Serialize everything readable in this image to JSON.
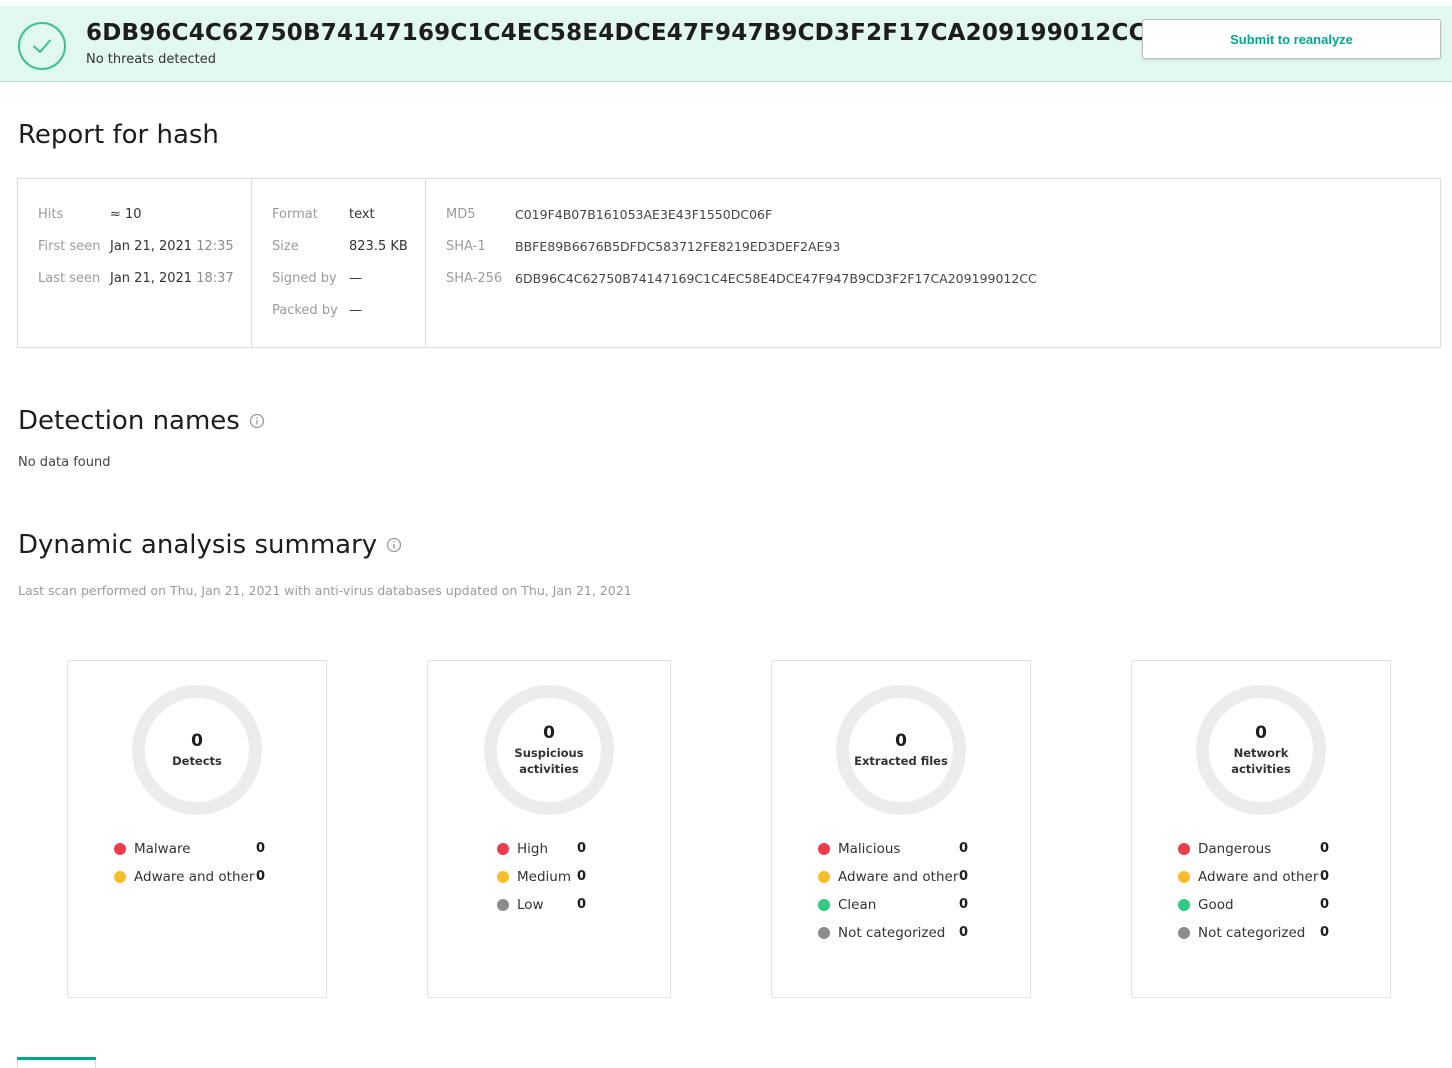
{
  "banner": {
    "hash": "6DB96C4C62750B74147169C1C4EC58E4DCE47F947B9CD3F2F17CA209199012CC",
    "status": "No threats detected",
    "button_label": "Submit to reanalyze",
    "accent_color": "#3fbf92",
    "background_color": "#e1f8ee",
    "icon": "check-circle-icon"
  },
  "report": {
    "title": "Report for hash",
    "hits_label": "Hits",
    "hits_value": "≈ 10",
    "first_seen_label": "First seen",
    "first_seen_date": "Jan 21, 2021",
    "first_seen_time": "12:35",
    "last_seen_label": "Last seen",
    "last_seen_date": "Jan 21, 2021",
    "last_seen_time": "18:37",
    "format_label": "Format",
    "format_value": "text",
    "size_label": "Size",
    "size_value": "823.5 KB",
    "signed_by_label": "Signed by",
    "signed_by_value": "—",
    "packed_by_label": "Packed by",
    "packed_by_value": "—",
    "md5_label": "MD5",
    "md5_value": "C019F4B07B161053AE3E43F1550DC06F",
    "sha1_label": "SHA-1",
    "sha1_value": "BBFE89B6676B5DFDC583712FE8219ED3DEF2AE93",
    "sha256_label": "SHA-256",
    "sha256_value": "6DB96C4C62750B74147169C1C4EC58E4DCE47F947B9CD3F2F17CA209199012CC"
  },
  "detection": {
    "title": "Detection names",
    "empty_text": "No data found"
  },
  "dynamic": {
    "title": "Dynamic analysis summary",
    "last_scan": "Last scan performed on Thu, Jan 21, 2021 with anti-virus databases updated on Thu, Jan 21, 2021",
    "cards": [
      {
        "value": "0",
        "caption_lines": [
          "Detects"
        ],
        "legend": [
          {
            "label": "Malware",
            "count": "0",
            "color": "#ec3c4d"
          },
          {
            "label": "Adware and other",
            "count": "0",
            "color": "#fbbd2c"
          }
        ]
      },
      {
        "value": "0",
        "caption_lines": [
          "Suspicious",
          "activities"
        ],
        "legend": [
          {
            "label": "High",
            "count": "0",
            "color": "#ec3c4d"
          },
          {
            "label": "Medium",
            "count": "0",
            "color": "#fbbd2c"
          },
          {
            "label": "Low",
            "count": "0",
            "color": "#8c8c8c"
          }
        ]
      },
      {
        "value": "0",
        "caption_lines": [
          "Extracted files"
        ],
        "legend": [
          {
            "label": "Malicious",
            "count": "0",
            "color": "#ec3c4d"
          },
          {
            "label": "Adware and other",
            "count": "0",
            "color": "#fbbd2c"
          },
          {
            "label": "Clean",
            "count": "0",
            "color": "#2ecb83"
          },
          {
            "label": "Not categorized",
            "count": "0",
            "color": "#8c8c8c"
          }
        ]
      },
      {
        "value": "0",
        "caption_lines": [
          "Network",
          "activities"
        ],
        "legend": [
          {
            "label": "Dangerous",
            "count": "0",
            "color": "#ec3c4d"
          },
          {
            "label": "Adware and other",
            "count": "0",
            "color": "#fbbd2c"
          },
          {
            "label": "Good",
            "count": "0",
            "color": "#2ecb83"
          },
          {
            "label": "Not categorized",
            "count": "0",
            "color": "#8c8c8c"
          }
        ]
      }
    ]
  }
}
